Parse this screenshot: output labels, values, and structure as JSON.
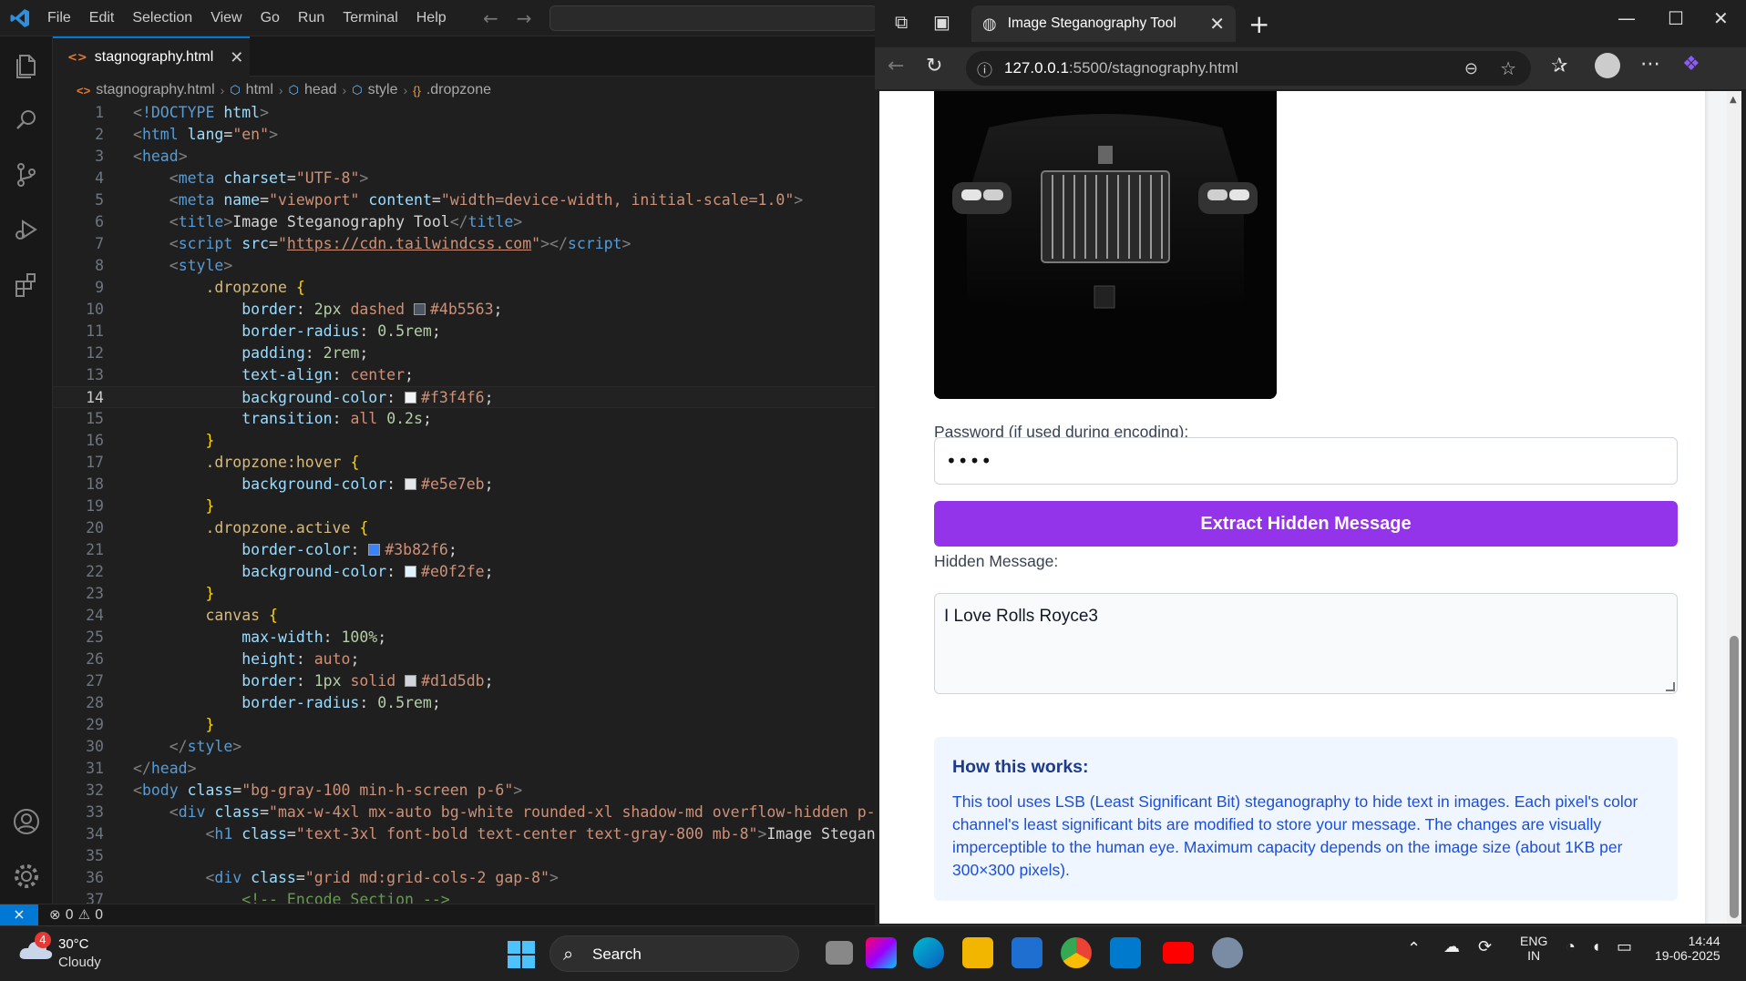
{
  "vscode": {
    "menu": [
      "File",
      "Edit",
      "Selection",
      "View",
      "Go",
      "Run",
      "Terminal",
      "Help"
    ],
    "tab": {
      "filename": "stagnography.html"
    },
    "breadcrumb": {
      "file": "stagnography.html",
      "c1": "html",
      "c2": "head",
      "c3": "style",
      "c4": ".dropzone"
    },
    "active_line": 14,
    "status": {
      "problems": "⊗ 0 ⚠ 0"
    }
  },
  "browser": {
    "tab_title": "Image Steganography Tool",
    "url_host": "127.0.0.1",
    "url_rest": ":5500/stagnography.html",
    "page": {
      "password_label": "Password (if used during encoding):",
      "password_value": "••••",
      "extract_button": "Extract Hidden Message",
      "hidden_label": "Hidden Message:",
      "hidden_value": "I Love Rolls Royce3",
      "info_title": "How this works:",
      "info_body": "This tool uses LSB (Least Significant Bit) steganography to hide text in images. Each pixel's color channel's least significant bits are modified to store your message. The changes are visually imperceptible to the human eye. Maximum capacity depends on the image size (about 1KB per 300×300 pixels)."
    }
  },
  "taskbar": {
    "weather_temp": "30°C",
    "weather_desc": "Cloudy",
    "weather_badge": "4",
    "search_label": "Search",
    "lang_1": "ENG",
    "lang_2": "IN",
    "time": "14:44",
    "date": "19-06-2025"
  }
}
